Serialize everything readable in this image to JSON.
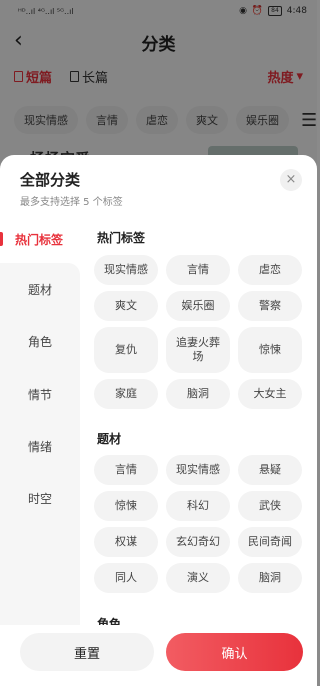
{
  "status_bar": {
    "signal": "ᴴᴰ..ıl ⁴ᴳ..ıl ⁵ᴳ..ıl",
    "icons": [
      "eye-icon",
      "alarm-icon",
      "battery-icon"
    ],
    "battery": "84",
    "time": "4:48"
  },
  "page": {
    "title": "分类"
  },
  "filters": {
    "short": "短篇",
    "long": "长篇",
    "hot": "热度"
  },
  "chips": [
    "现实情感",
    "言情",
    "虐恋",
    "爽文",
    "娱乐圈"
  ],
  "peek_title": "杨杨宝爱",
  "sheet": {
    "title": "全部分类",
    "subtitle": "最多支持选择 5 个标签",
    "close": "×"
  },
  "sidebar": {
    "items": [
      {
        "label": "热门标签"
      },
      {
        "label": "题材"
      },
      {
        "label": "角色"
      },
      {
        "label": "情节"
      },
      {
        "label": "情绪"
      },
      {
        "label": "时空"
      }
    ]
  },
  "sections": [
    {
      "title": "热门标签",
      "tags": [
        "现实情感",
        "言情",
        "虐恋",
        "爽文",
        "娱乐圈",
        "警察",
        "复仇",
        "追妻火葬场",
        "惊悚",
        "家庭",
        "脑洞",
        "大女主"
      ]
    },
    {
      "title": "题材",
      "tags": [
        "言情",
        "现实情感",
        "悬疑",
        "惊悚",
        "科幻",
        "武侠",
        "权谋",
        "玄幻奇幻",
        "民间奇闻",
        "同人",
        "演义",
        "脑洞"
      ]
    },
    {
      "title": "角色",
      "tags": []
    }
  ],
  "footer": {
    "reset": "重置",
    "confirm": "确认"
  },
  "colors": {
    "accent": "#e8323c",
    "tag_bg": "#f3f3f3"
  }
}
